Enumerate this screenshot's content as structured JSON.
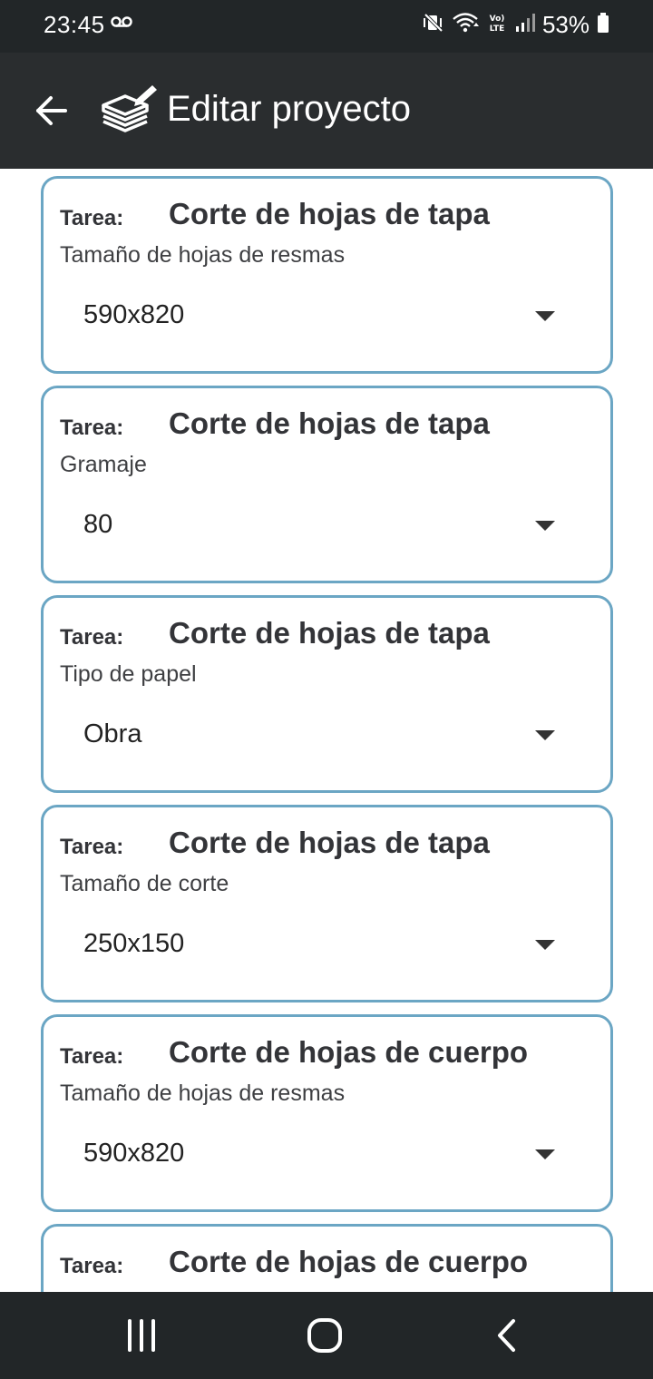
{
  "status_bar": {
    "time": "23:45",
    "battery_percent": "53%",
    "icons": [
      "voicemail-icon",
      "mute-vibrate-icon",
      "wifi-icon",
      "volte-icon",
      "signal-icon",
      "battery-icon"
    ]
  },
  "app_bar": {
    "title": "Editar proyecto",
    "back_icon": "arrow-left-icon",
    "app_icon": "paper-stack-edit-icon"
  },
  "cards": [
    {
      "tarea_label": "Tarea:",
      "tarea": "Corte de hojas de tapa",
      "field": "Tamaño de hojas de resmas",
      "value": "590x820"
    },
    {
      "tarea_label": "Tarea:",
      "tarea": "Corte de hojas de tapa",
      "field": "Gramaje",
      "value": "80"
    },
    {
      "tarea_label": "Tarea:",
      "tarea": "Corte de hojas de tapa",
      "field": "Tipo de papel",
      "value": "Obra"
    },
    {
      "tarea_label": "Tarea:",
      "tarea": "Corte de hojas de tapa",
      "field": "Tamaño de corte",
      "value": "250x150"
    },
    {
      "tarea_label": "Tarea:",
      "tarea": "Corte de hojas de cuerpo",
      "field": "Tamaño de hojas de resmas",
      "value": "590x820"
    },
    {
      "tarea_label": "Tarea:",
      "tarea": "Corte de hojas de cuerpo",
      "field": "",
      "value": ""
    }
  ],
  "nav_bar": {
    "recents_icon": "recents-icon",
    "home_icon": "home-icon",
    "back_icon": "chevron-left-icon"
  },
  "colors": {
    "app_bar": "#2a2d2f",
    "status_bar": "#222628",
    "card_border": "#6ba6c4",
    "text_dark": "#333438"
  }
}
